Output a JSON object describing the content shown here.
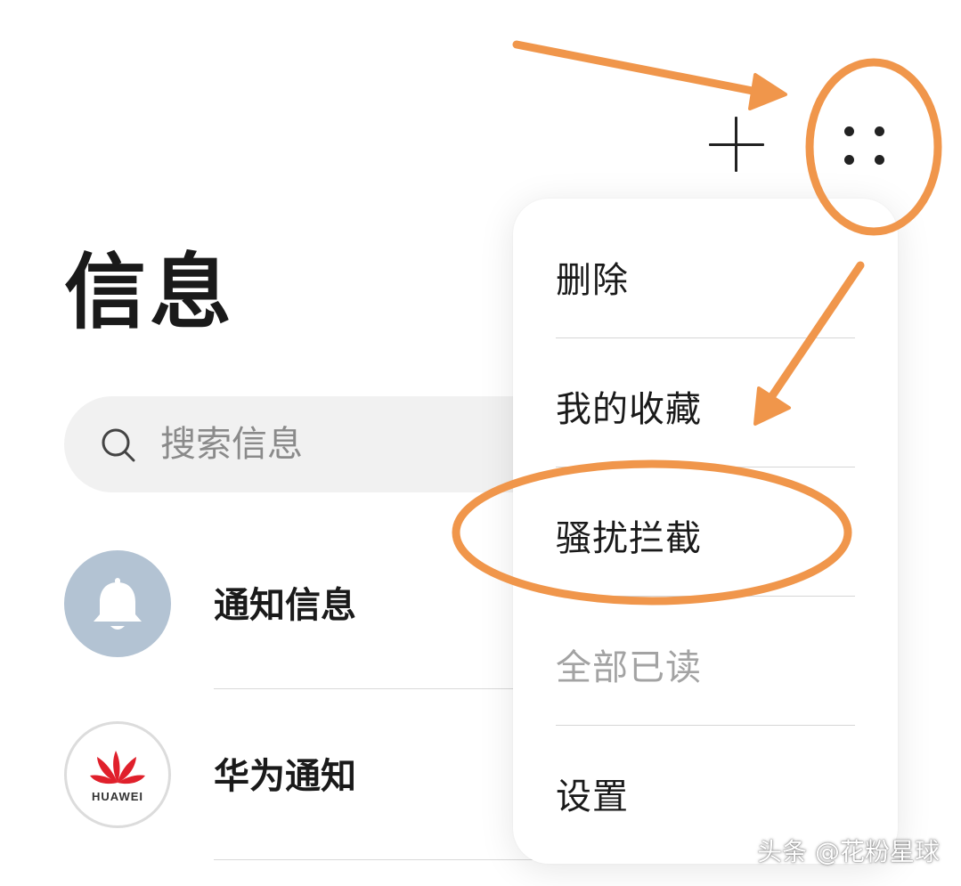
{
  "header": {
    "title": "信息",
    "add_icon": "plus-icon",
    "more_icon": "more-dots-icon"
  },
  "search": {
    "placeholder": "搜索信息",
    "icon": "search-icon"
  },
  "conversations": [
    {
      "title": "通知信息",
      "avatar": "bell-icon",
      "avatar_color": "#b3c3d3"
    },
    {
      "title": "华为通知",
      "avatar": "huawei-logo",
      "avatar_text": "HUAWEI",
      "avatar_color": "#e0202b"
    }
  ],
  "menu": {
    "items": [
      {
        "label": "删除",
        "enabled": true
      },
      {
        "label": "我的收藏",
        "enabled": true
      },
      {
        "label": "骚扰拦截",
        "enabled": true,
        "highlighted": true
      },
      {
        "label": "全部已读",
        "enabled": false
      },
      {
        "label": "设置",
        "enabled": true
      }
    ]
  },
  "annotations": {
    "color": "#f0964b"
  },
  "watermark": "头条 @花粉星球",
  "colors": {
    "accent_annotation": "#f0964b",
    "text_primary": "#1a1a1a",
    "text_disabled": "#a3a3a3",
    "search_bg": "#f1f1f1"
  }
}
